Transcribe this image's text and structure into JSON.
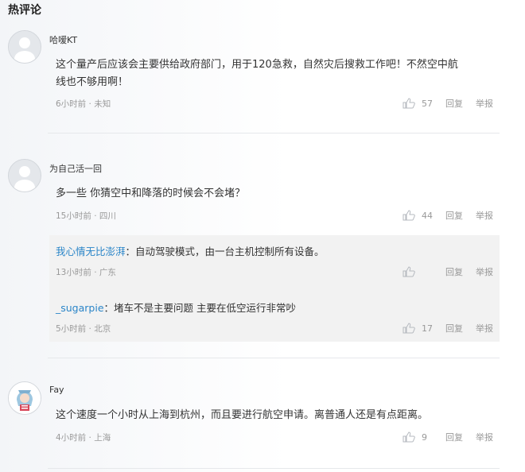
{
  "section_title": "热评论",
  "comments": [
    {
      "username": "哈嗳KT",
      "text_line1": "这个量产后应该会主要供给政府部门，用于120急救，自然灾后搜救工作吧！不然空中航",
      "text_line2": "线也不够用啊！",
      "time": "6小时前 · 未知",
      "likes": "57",
      "reply_label": "回复",
      "report_label": "举报"
    },
    {
      "username": "为自己活一回",
      "text_line1": "多一些 你猜空中和降落的时候会不会堵？",
      "time": "15小时前 · 四川",
      "likes": "44",
      "reply_label": "回复",
      "report_label": "举报",
      "replies": [
        {
          "username": "我心情无比澎湃",
          "separator": "：",
          "text": "自动驾驶模式，由一台主机控制所有设备。",
          "time": "13小时前 · 广东",
          "likes": "",
          "reply_label": "回复",
          "report_label": "举报"
        },
        {
          "username": "_sugarpie",
          "separator": "：",
          "text": "堵车不是主要问题 主要在低空运行非常吵",
          "time": "5小时前 · 北京",
          "likes": "17",
          "reply_label": "回复",
          "report_label": "举报"
        }
      ]
    },
    {
      "username": "Fay",
      "text_line1": "这个速度一个小时从上海到杭州，而且要进行航空申请。离普通人还是有点距离。",
      "time": "4小时前 · 上海",
      "likes": "9",
      "reply_label": "回复",
      "report_label": "举报"
    }
  ]
}
